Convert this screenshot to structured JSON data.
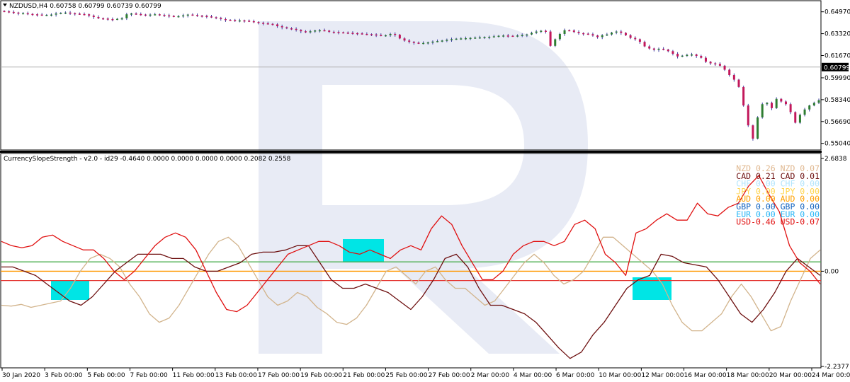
{
  "chart_data": [
    {
      "type": "candlestick",
      "symbol_header": "NZDUSD,H4  0.60758 0.60799 0.60739 0.60799",
      "current_price_label": "0.60799",
      "current_price": 0.60799,
      "ylim": [
        0.5465,
        0.657
      ],
      "y_ticks": [
        "0.64970",
        "0.63320",
        "0.61670",
        "0.59990",
        "0.58340",
        "0.56690",
        "0.55040"
      ],
      "up_color": "#2e7d32",
      "down_color": "#c2185b",
      "candles_close": [
        0.65,
        0.6496,
        0.6491,
        0.6486,
        0.6486,
        0.6481,
        0.6478,
        0.6476,
        0.6472,
        0.6474,
        0.6476,
        0.6484,
        0.6488,
        0.6491,
        0.6486,
        0.6483,
        0.648,
        0.6478,
        0.6468,
        0.6458,
        0.6448,
        0.6446,
        0.6442,
        0.644,
        0.6444,
        0.6448,
        0.6478,
        0.6484,
        0.648,
        0.6476,
        0.6474,
        0.6476,
        0.6478,
        0.6474,
        0.647,
        0.6466,
        0.6462,
        0.6464,
        0.647,
        0.6476,
        0.6472,
        0.6468,
        0.6466,
        0.6462,
        0.6456,
        0.645,
        0.6442,
        0.6436,
        0.6434,
        0.643,
        0.6432,
        0.643,
        0.6426,
        0.642,
        0.6414,
        0.641,
        0.6406,
        0.6402,
        0.6388,
        0.638,
        0.6372,
        0.6368,
        0.636,
        0.635,
        0.6342,
        0.635,
        0.6356,
        0.6358,
        0.6355,
        0.6346,
        0.6344,
        0.6342,
        0.634,
        0.6338,
        0.6336,
        0.6334,
        0.633,
        0.6328,
        0.6326,
        0.6322,
        0.6318,
        0.632,
        0.633,
        0.6324,
        0.6296,
        0.628,
        0.627,
        0.6264,
        0.626,
        0.6262,
        0.6266,
        0.6272,
        0.6276,
        0.628,
        0.6286,
        0.629,
        0.6294,
        0.6296,
        0.6298,
        0.63,
        0.6302,
        0.6304,
        0.6306,
        0.6308,
        0.6312,
        0.6316,
        0.6318,
        0.6316,
        0.6314,
        0.6318,
        0.6322,
        0.6326,
        0.6338,
        0.6348,
        0.6354,
        0.6348,
        0.624,
        0.629,
        0.633,
        0.6358,
        0.6356,
        0.6345,
        0.6336,
        0.6332,
        0.6328,
        0.6318,
        0.6306,
        0.632,
        0.6326,
        0.634,
        0.6348,
        0.6338,
        0.632,
        0.63,
        0.629,
        0.627,
        0.6236,
        0.622,
        0.621,
        0.6218,
        0.6212,
        0.62,
        0.618,
        0.616,
        0.6166,
        0.6172,
        0.6175,
        0.6164,
        0.615,
        0.612,
        0.6108,
        0.6104,
        0.609,
        0.606,
        0.602,
        0.5985,
        0.593,
        0.579,
        0.564,
        0.554,
        0.57,
        0.58,
        0.581,
        0.577,
        0.584,
        0.582,
        0.58,
        0.574,
        0.566,
        0.572,
        0.576,
        0.579,
        0.581,
        0.583
      ]
    },
    {
      "type": "line",
      "header": "CurrencySlopeStrength - v2.0 - id29 -0.4640 0.0000 0.0000 0.0000 0.0000 0.2082 0.2558",
      "ylim": [
        -2.2377,
        2.6838
      ],
      "y_ticks": [
        "2.6838",
        "0.00",
        "-2.2377"
      ],
      "levels": [
        {
          "value": 0.22,
          "color": "#4caf50"
        },
        {
          "value": 0.0,
          "color": "#ff9800"
        },
        {
          "value": -0.22,
          "color": "#e53935"
        }
      ],
      "series": [
        {
          "name": "NZD",
          "color": "#d2b48c",
          "values": [
            -0.8,
            -0.82,
            -0.78,
            -0.85,
            -0.8,
            -0.75,
            -0.7,
            -0.4,
            0.0,
            0.3,
            0.4,
            0.3,
            0.1,
            -0.3,
            -0.6,
            -1.0,
            -1.2,
            -1.1,
            -0.8,
            -0.4,
            0.0,
            0.4,
            0.7,
            0.8,
            0.6,
            0.2,
            -0.2,
            -0.6,
            -0.8,
            -0.7,
            -0.5,
            -0.6,
            -0.85,
            -1.0,
            -1.2,
            -1.25,
            -1.1,
            -0.8,
            -0.4,
            0.0,
            0.1,
            -0.1,
            -0.3,
            0.0,
            0.1,
            -0.2,
            -0.4,
            -0.4,
            -0.6,
            -0.8,
            -0.7,
            -0.4,
            -0.1,
            0.2,
            0.4,
            0.2,
            -0.1,
            -0.3,
            -0.2,
            0.0,
            0.4,
            0.8,
            0.8,
            0.6,
            0.4,
            0.2,
            0.0,
            -0.3,
            -0.8,
            -1.2,
            -1.4,
            -1.4,
            -1.2,
            -1.0,
            -0.6,
            -0.3,
            -0.6,
            -1.0,
            -1.4,
            -1.3,
            -0.7,
            -0.2,
            0.3,
            0.5
          ]
        },
        {
          "name": "CAD",
          "color": "#6d0f0f",
          "values": [
            0.1,
            0.1,
            0.0,
            -0.1,
            -0.3,
            -0.5,
            -0.7,
            -0.8,
            -0.6,
            -0.3,
            0.0,
            0.2,
            0.4,
            0.4,
            0.4,
            0.3,
            0.3,
            0.1,
            0.0,
            0.0,
            0.1,
            0.2,
            0.4,
            0.45,
            0.45,
            0.5,
            0.6,
            0.6,
            0.2,
            -0.2,
            -0.4,
            -0.4,
            -0.3,
            -0.4,
            -0.5,
            -0.7,
            -0.9,
            -0.6,
            -0.2,
            0.3,
            0.4,
            0.1,
            -0.4,
            -0.8,
            -0.8,
            -0.9,
            -1.0,
            -1.2,
            -1.5,
            -1.8,
            -2.05,
            -1.9,
            -1.5,
            -1.2,
            -0.8,
            -0.4,
            -0.2,
            -0.1,
            0.4,
            0.35,
            0.2,
            0.15,
            0.1,
            -0.2,
            -0.6,
            -1.0,
            -1.2,
            -0.9,
            -0.5,
            0.0,
            0.3,
            0.1,
            -0.1
          ]
        },
        {
          "name": "USD",
          "color": "#e01010",
          "values": [
            0.7,
            0.6,
            0.55,
            0.6,
            0.8,
            0.85,
            0.7,
            0.6,
            0.5,
            0.5,
            0.3,
            0.0,
            -0.2,
            0.0,
            0.3,
            0.6,
            0.8,
            0.9,
            0.8,
            0.5,
            0.0,
            -0.5,
            -0.9,
            -0.95,
            -0.8,
            -0.5,
            -0.2,
            0.1,
            0.4,
            0.5,
            0.6,
            0.7,
            0.7,
            0.6,
            0.45,
            0.4,
            0.5,
            0.4,
            0.3,
            0.5,
            0.6,
            0.5,
            1.0,
            1.3,
            1.1,
            0.6,
            0.2,
            -0.2,
            -0.2,
            0.0,
            0.4,
            0.6,
            0.7,
            0.7,
            0.6,
            0.7,
            1.1,
            1.2,
            1.0,
            0.4,
            0.2,
            -0.1,
            0.9,
            1.0,
            1.2,
            1.35,
            1.2,
            1.2,
            1.6,
            1.35,
            1.3,
            1.5,
            1.6,
            2.0,
            2.25,
            1.8,
            1.4,
            0.6,
            0.2,
            0.0,
            -0.3
          ]
        }
      ],
      "legend_items": [
        {
          "label": "NZD 0.26 NZD 0.07",
          "color": "#e0b890"
        },
        {
          "label": "CAD 0.21 CAD 0.01",
          "color": "#6d0f0f"
        },
        {
          "label": "CHF 0.00 CHF 0.00",
          "color": "#b3e5fc"
        },
        {
          "label": "JPY 0.00 JPY 0.00",
          "color": "#ffd54f"
        },
        {
          "label": "AUD 0.00 AUD 0.00",
          "color": "#ffa000"
        },
        {
          "label": "GBP 0.00 GBP 0.00",
          "color": "#1565c0"
        },
        {
          "label": "EUR 0.00 EUR 0.00",
          "color": "#29b6f6"
        },
        {
          "label": "USD-0.46 USD-0.07",
          "color": "#e01010"
        }
      ]
    }
  ],
  "x_tick_labels": [
    "30 Jan 2020",
    "3 Feb 00:00",
    "5 Feb 00:00",
    "7 Feb 00:00",
    "11 Feb 00:00",
    "13 Feb 00:00",
    "17 Feb 00:00",
    "19 Feb 00:00",
    "21 Feb 00:00",
    "25 Feb 00:00",
    "27 Feb 00:00",
    "2 Mar 00:00",
    "4 Mar 00:00",
    "6 Mar 00:00",
    "10 Mar 00:00",
    "12 Mar 00:00",
    "16 Mar 00:00",
    "18 Mar 00:00",
    "20 Mar 00:00",
    "24 Mar 00:00"
  ],
  "highlight_color": "#00e5e5",
  "watermark_color": "#e8ebf5"
}
